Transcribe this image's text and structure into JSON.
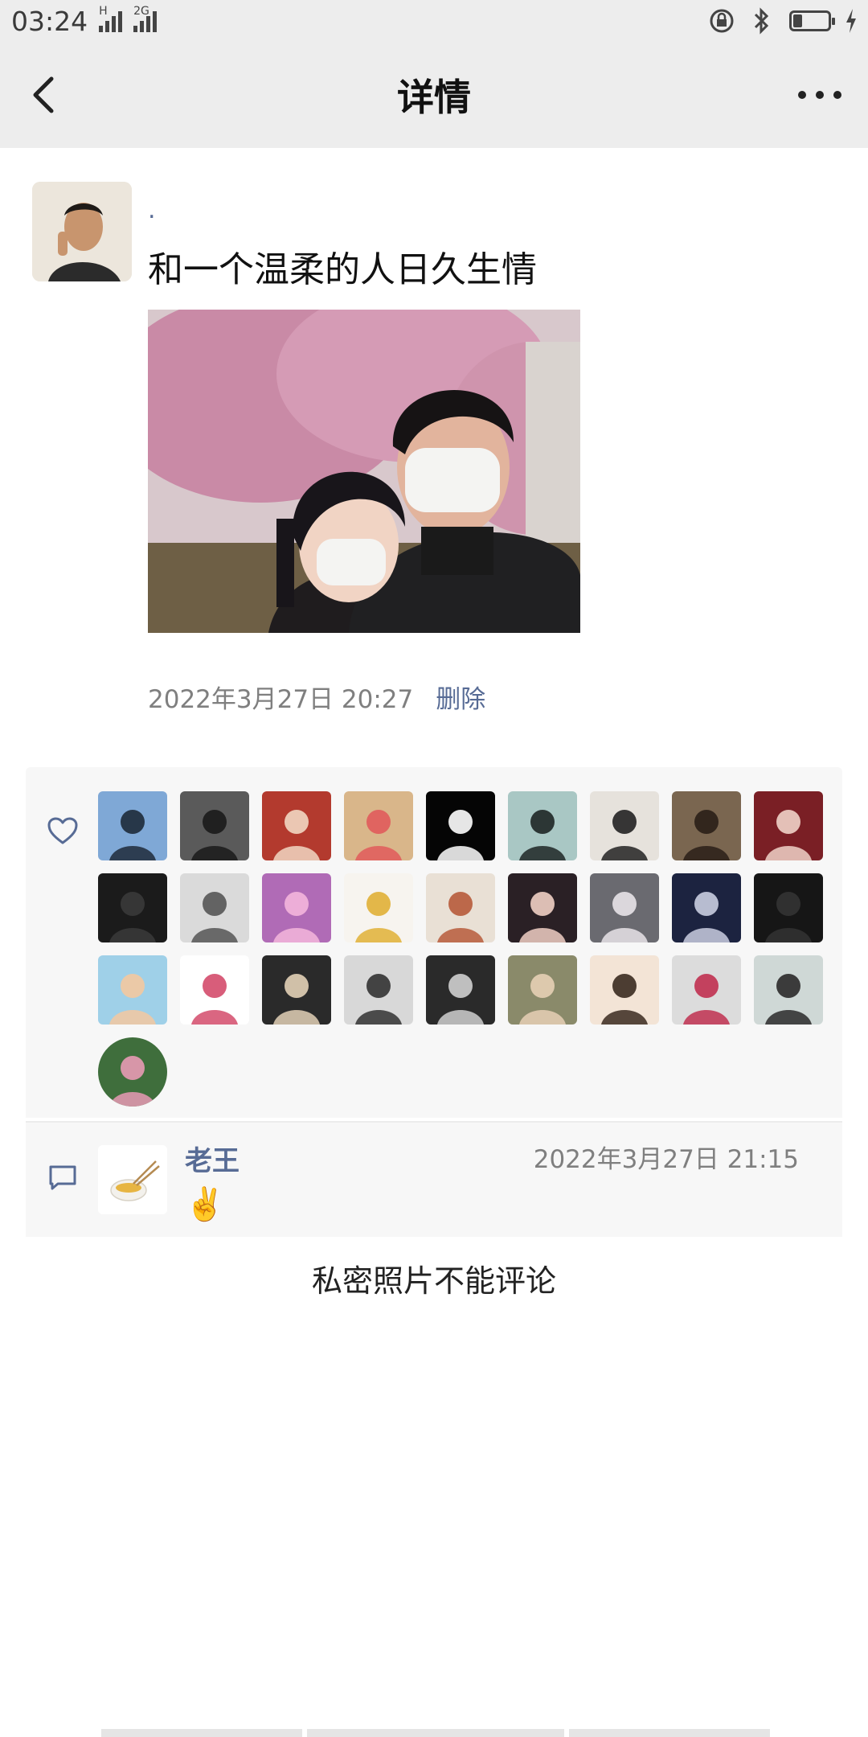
{
  "status_bar": {
    "time": "03:24",
    "signal1_tag": "H",
    "signal2_tag": "2G",
    "icons": [
      "lock-rotation-icon",
      "bluetooth-icon",
      "battery-icon",
      "charging-icon"
    ],
    "battery_level": 0.25
  },
  "nav": {
    "title": "详情",
    "back_icon": "back-arrow-icon",
    "more_icon": "more-dots-icon"
  },
  "post": {
    "author_name": ".",
    "text": "和一个温柔的人日久生情",
    "time": "2022年3月27日 20:27",
    "delete_label": "删除"
  },
  "likes": {
    "icon": "heart-icon",
    "avatars": [
      {
        "name": "avatar-girl-blue-sky",
        "bg": "#7fa8d6",
        "fg": "#1e2a3a"
      },
      {
        "name": "avatar-man-grey",
        "bg": "#5a5a5a",
        "fg": "#1a1a1a"
      },
      {
        "name": "avatar-couple-red",
        "bg": "#b33a2e",
        "fg": "#f1d7c2"
      },
      {
        "name": "avatar-cartoon-girl",
        "bg": "#d9b68a",
        "fg": "#e05b5b"
      },
      {
        "name": "avatar-galaxy",
        "bg": "#050505",
        "fg": "#ffffff"
      },
      {
        "name": "avatar-man-suit",
        "bg": "#a9c7c4",
        "fg": "#1e2626"
      },
      {
        "name": "avatar-bunny-toy",
        "bg": "#e6e2dc",
        "fg": "#222222"
      },
      {
        "name": "avatar-man-portrait",
        "bg": "#7a6650",
        "fg": "#2a1f17"
      },
      {
        "name": "avatar-woman-red",
        "bg": "#7a1f25",
        "fg": "#f0d2c8"
      },
      {
        "name": "avatar-dark-hand",
        "bg": "#1b1b1b",
        "fg": "#3a3a3a"
      },
      {
        "name": "avatar-bw-couple",
        "bg": "#dadada",
        "fg": "#555555"
      },
      {
        "name": "avatar-pink-dress",
        "bg": "#b06bb6",
        "fg": "#f4b6dc"
      },
      {
        "name": "avatar-noodle-bowl",
        "bg": "#f7f4ef",
        "fg": "#e0b036"
      },
      {
        "name": "avatar-cartoon-face",
        "bg": "#e9e0d5",
        "fg": "#b75b3b"
      },
      {
        "name": "avatar-girl-dark",
        "bg": "#2a2025",
        "fg": "#f0cfc4"
      },
      {
        "name": "avatar-wedding",
        "bg": "#6a6a70",
        "fg": "#e8e3e8"
      },
      {
        "name": "avatar-car-night",
        "bg": "#1c2340",
        "fg": "#c9cde0"
      },
      {
        "name": "avatar-man-mask",
        "bg": "#161616",
        "fg": "#333333"
      },
      {
        "name": "avatar-shinchan",
        "bg": "#9fd0e8",
        "fg": "#f3c8a0"
      },
      {
        "name": "avatar-smiley",
        "bg": "#ffffff",
        "fg": "#d44b6b"
      },
      {
        "name": "avatar-boy-tie",
        "bg": "#2a2a2a",
        "fg": "#e2d0b6"
      },
      {
        "name": "avatar-man-sign",
        "bg": "#d8d8d8",
        "fg": "#333333"
      },
      {
        "name": "avatar-logo-dark",
        "bg": "#2a2a2a",
        "fg": "#cfcfcf"
      },
      {
        "name": "avatar-man-hat",
        "bg": "#8a8a6a",
        "fg": "#e6cfb5"
      },
      {
        "name": "avatar-li-character",
        "bg": "#f3e4d6",
        "fg": "#3a2a20"
      },
      {
        "name": "avatar-love-taste",
        "bg": "#dcdcdc",
        "fg": "#c03050"
      },
      {
        "name": "avatar-woman-smile",
        "bg": "#cfd8d6",
        "fg": "#2a2a2a"
      },
      {
        "name": "avatar-lotus",
        "bg": "#3f6e3c",
        "fg": "#e89ab4"
      }
    ]
  },
  "comment": {
    "icon": "comment-icon",
    "author": "老王",
    "time": "2022年3月27日 21:15",
    "text": "✌️"
  },
  "private_note": "私密照片不能评论"
}
